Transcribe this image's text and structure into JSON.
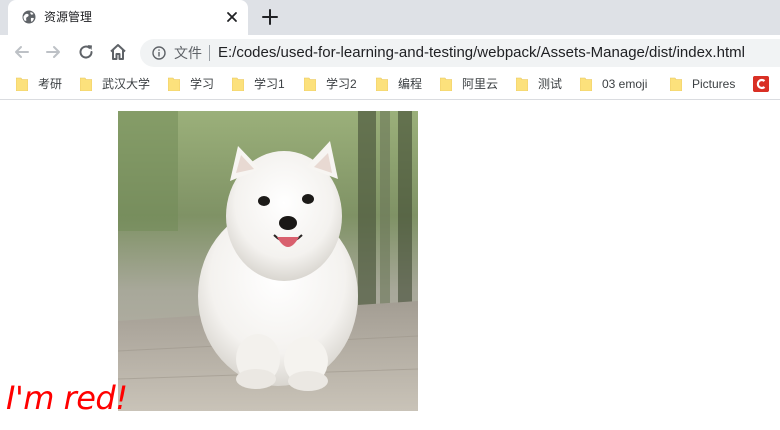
{
  "tab": {
    "title": "资源管理",
    "favicon": "globe-icon"
  },
  "toolbar": {
    "scheme_label": "文件",
    "url": "E:/codes/used-for-learning-and-testing/webpack/Assets-Manage/dist/index.html"
  },
  "bookmarks": {
    "items": [
      {
        "label": "考研"
      },
      {
        "label": "武汉大学"
      },
      {
        "label": "学习"
      },
      {
        "label": "学习1"
      },
      {
        "label": "学习2"
      },
      {
        "label": "编程"
      },
      {
        "label": "阿里云"
      },
      {
        "label": "测试"
      },
      {
        "label": "03 emoji"
      },
      {
        "label": "Pictures"
      }
    ],
    "overflow_icon": "c-logo-icon"
  },
  "page": {
    "red_text": "I'm red!",
    "image": "samoyed-puppy-photo"
  },
  "colors": {
    "red_text": "#ff0000",
    "tabstrip": "#dee1e6",
    "omnibox": "#f1f3f4",
    "folder": "#fce17c"
  }
}
